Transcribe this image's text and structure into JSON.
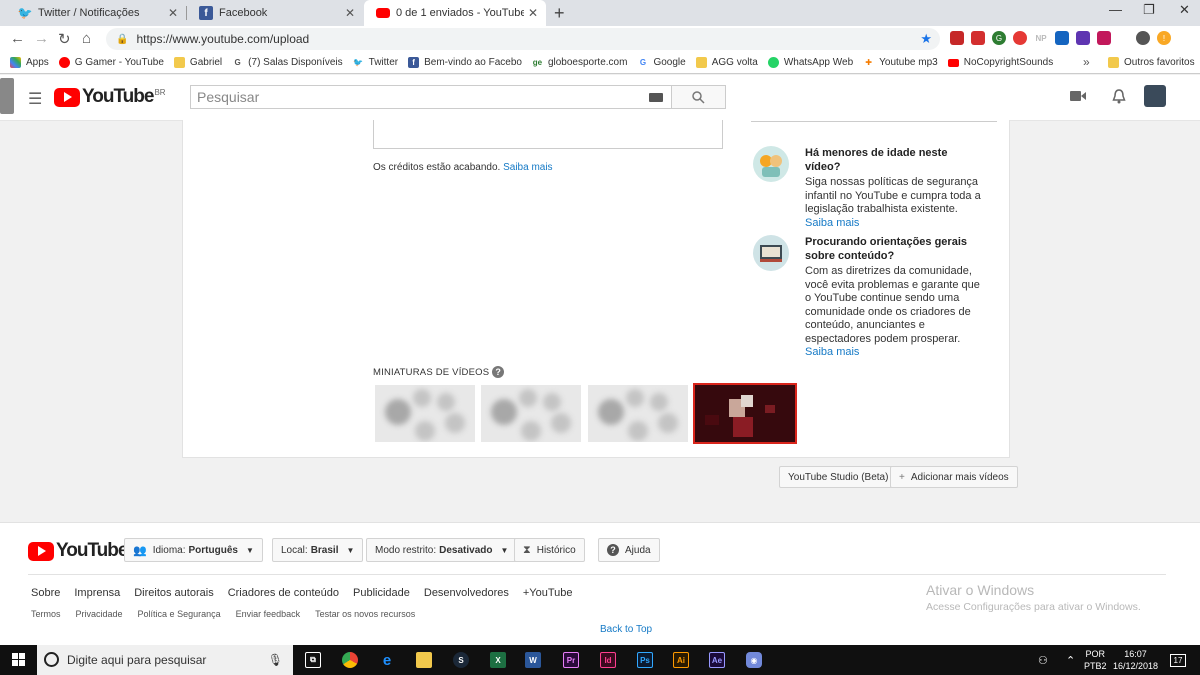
{
  "browser": {
    "tabs": [
      {
        "title": "Twitter / Notificações",
        "icon": "twitter-icon",
        "active": false
      },
      {
        "title": "Facebook",
        "icon": "facebook-icon",
        "active": false
      },
      {
        "title": "0 de 1 enviados - YouTube",
        "icon": "youtube-icon",
        "active": true
      }
    ],
    "url": "https://www.youtube.com/upload",
    "bookmarks": [
      {
        "label": "Apps",
        "icon": "apps-grid-icon",
        "color": "#e44"
      },
      {
        "label": "G Gamer - YouTube",
        "icon": "youtube-icon",
        "color": "#f00"
      },
      {
        "label": "Gabriel",
        "icon": "folder-icon",
        "color": "#f2c94c"
      },
      {
        "label": "(7) Salas Disponíveis",
        "icon": "g-icon",
        "color": "#4285f4"
      },
      {
        "label": "Twitter",
        "icon": "twitter-icon",
        "color": "#1da1f2"
      },
      {
        "label": "Bem-vindo ao Facebo",
        "icon": "facebook-icon",
        "color": "#3b5998"
      },
      {
        "label": "globoesporte.com",
        "icon": "ge-icon",
        "color": "#2e7d32"
      },
      {
        "label": "Google",
        "icon": "google-icon",
        "color": "#4285f4"
      },
      {
        "label": "AGG volta",
        "icon": "folder-icon",
        "color": "#f2c94c"
      },
      {
        "label": "WhatsApp Web",
        "icon": "whatsapp-icon",
        "color": "#25d366"
      },
      {
        "label": "Youtube mp3",
        "icon": "mp3-icon",
        "color": "#f57c00"
      },
      {
        "label": "NoCopyrightSounds",
        "icon": "youtube-icon",
        "color": "#f00"
      }
    ],
    "other_bookmarks": "Outros favoritos"
  },
  "masthead": {
    "logo_text": "YouTube",
    "country": "BR",
    "search_placeholder": "Pesquisar"
  },
  "upload": {
    "credits_text": "Os créditos estão acabando.",
    "credits_link": "Saiba mais",
    "tips": [
      {
        "title": "Há menores de idade neste vídeo?",
        "body": "Siga nossas políticas de segurança infantil no YouTube e cumpra toda a legislação trabalhista existente.",
        "link": "Saiba mais"
      },
      {
        "title": "Procurando orientações gerais sobre conteúdo?",
        "body": "Com as diretrizes da comunidade, você evita problemas e garante que o YouTube continue sendo uma comunidade onde os criadores de conteúdo, anunciantes e espectadores podem prosperar.",
        "link": "Saiba mais"
      }
    ],
    "thumbnails_label": "MINIATURAS DE VÍDEOS",
    "thumbnails": [
      "processing",
      "processing",
      "processing",
      "selected"
    ],
    "studio_button": "YouTube Studio (Beta)",
    "add_more_button": "Adicionar mais vídeos"
  },
  "footer": {
    "logo_text": "YouTube",
    "language_label": "Idioma:",
    "language_value": "Português",
    "location_label": "Local:",
    "location_value": "Brasil",
    "restricted_label": "Modo restrito:",
    "restricted_value": "Desativado",
    "history": "Histórico",
    "help": "Ajuda",
    "links_primary": [
      "Sobre",
      "Imprensa",
      "Direitos autorais",
      "Criadores de conteúdo",
      "Publicidade",
      "Desenvolvedores",
      "+YouTube"
    ],
    "links_secondary": [
      "Termos",
      "Privacidade",
      "Política e Segurança",
      "Enviar feedback",
      "Testar os novos recursos"
    ],
    "back_to_top": "Back to Top",
    "watermark_title": "Ativar o Windows",
    "watermark_body": "Acesse Configurações para ativar o Windows."
  },
  "taskbar": {
    "search_placeholder": "Digite aqui para pesquisar",
    "language": "POR",
    "layout": "PTB2",
    "time": "16:07",
    "date": "16/12/2018",
    "notifications": "17"
  },
  "colors": {
    "youtube_red": "#ff0000",
    "link_blue": "#167ac6",
    "selected_border": "#d9251c"
  }
}
